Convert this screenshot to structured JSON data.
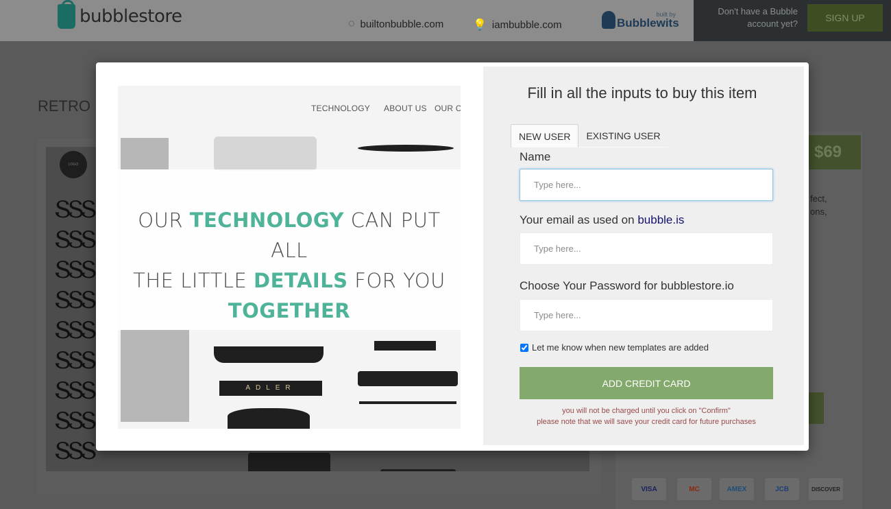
{
  "header": {
    "brand": "bubblestore",
    "links": [
      "builtonbubble.com",
      "iambubble.com"
    ],
    "partner_small": "built by",
    "partner_name": "Bubblewits",
    "account_prompt": "Don't have a Bubble account yet?",
    "signup_label": "SIGN UP"
  },
  "background": {
    "page_title": "RETRO",
    "logo_badge": "LOGO",
    "price": "$69",
    "desc_lines": [
      "fect,",
      "ons,"
    ],
    "card_brands": [
      "VISA",
      "MC",
      "AMEX",
      "JCB",
      "DISCOVER"
    ]
  },
  "modal": {
    "image": {
      "nav": [
        "TECHNOLOGY",
        "ABOUT US",
        "OUR C"
      ],
      "headline": {
        "line1": [
          "OUR ",
          "TECHNOLOGY",
          " CAN  PUT ALL"
        ],
        "line2": [
          "THE LITTLE ",
          "DETAILS",
          " FOR YOU"
        ],
        "line3": "TOGETHER"
      },
      "plate_text": "ADLER"
    },
    "form": {
      "title": "Fill in all the inputs to buy this item",
      "tabs": [
        "NEW USER",
        "EXISTING USER"
      ],
      "name_label": "Name",
      "email_label": "Your email as used on ",
      "email_link": "bubble.is",
      "password_label": "Choose Your Password for bubblestore.io",
      "placeholder": "Type here...",
      "checkbox_label": "Let me know when new templates are added",
      "checkbox_checked": true,
      "cta_label": "ADD CREDIT CARD",
      "note_line1": "you will not be charged until you click on \"Confirm\"",
      "note_line2": "please note that we will save your credit card for future purchases"
    }
  },
  "colors": {
    "accent_green": "#84a96c",
    "headline_teal": "#4fb39a",
    "link_navy": "#14146e",
    "note_red": "#9a4a4a"
  }
}
